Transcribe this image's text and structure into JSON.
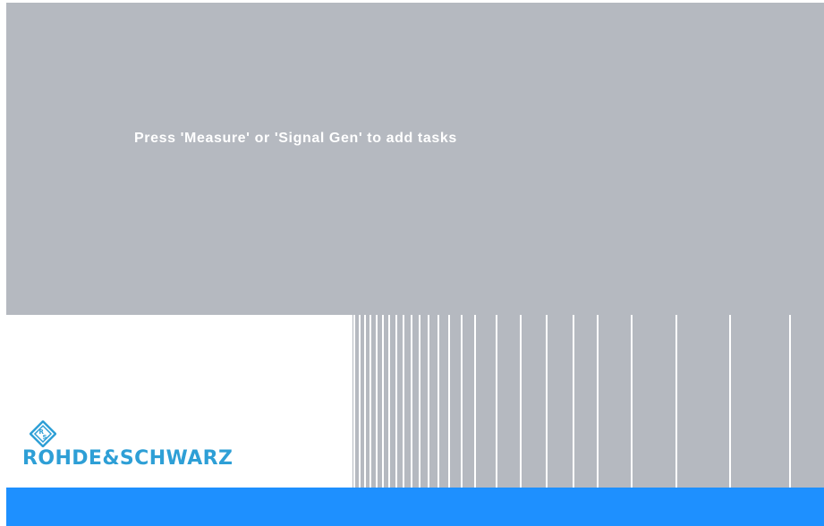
{
  "main": {
    "hint_text": "Press 'Measure' or 'Signal Gen' to add tasks"
  },
  "branding": {
    "logo_icon": "rohde-schwarz-diamond-logo",
    "company_name": "ROHDE&SCHWARZ",
    "brand_color": "#2E9FD6"
  },
  "colors": {
    "panel_gray": "#B5B9C0",
    "status_bar_blue": "#1E90FF",
    "background_white": "#FFFFFF"
  }
}
